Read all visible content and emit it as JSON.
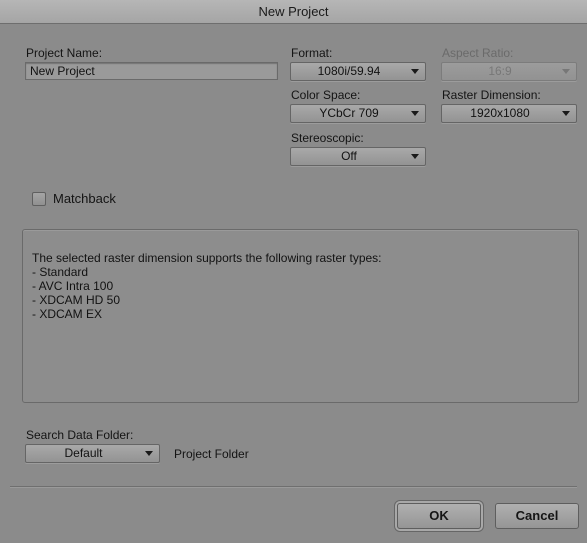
{
  "window": {
    "title": "New Project"
  },
  "project_name": {
    "label": "Project Name:",
    "value": "New Project"
  },
  "format": {
    "label": "Format:",
    "value": "1080i/59.94"
  },
  "aspect_ratio": {
    "label": "Aspect Ratio:",
    "value": "16:9",
    "enabled": false
  },
  "color_space": {
    "label": "Color Space:",
    "value": "YCbCr 709"
  },
  "raster_dimension": {
    "label": "Raster Dimension:",
    "value": "1920x1080"
  },
  "stereoscopic": {
    "label": "Stereoscopic:",
    "value": "Off"
  },
  "matchback": {
    "label": "Matchback",
    "checked": false
  },
  "info": {
    "heading": "The selected raster dimension supports the following raster types:",
    "items": [
      " - Standard",
      " - AVC Intra 100",
      " - XDCAM HD 50",
      " - XDCAM EX"
    ]
  },
  "search_data_folder": {
    "label": "Search Data Folder:",
    "value": "Default",
    "path_label": "Project Folder"
  },
  "buttons": {
    "ok": "OK",
    "cancel": "Cancel"
  }
}
